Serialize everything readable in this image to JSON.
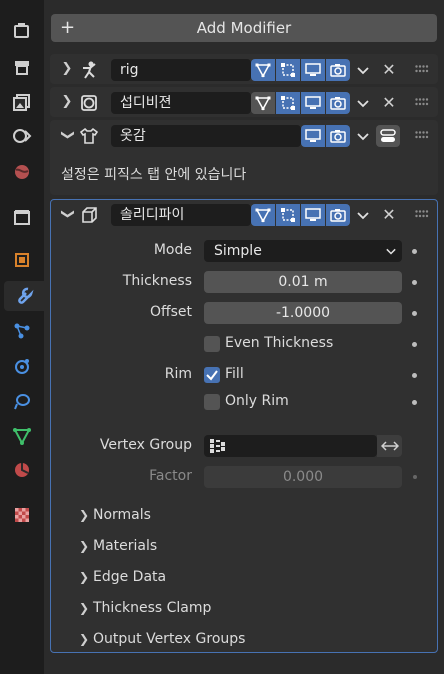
{
  "sidebar": {
    "tabs": [
      {
        "name": "tool-icon"
      },
      {
        "name": "render-icon"
      },
      {
        "name": "output-icon"
      },
      {
        "name": "view-layer-icon"
      },
      {
        "name": "scene-icon"
      },
      {
        "name": "world-icon"
      },
      {
        "name": "collection-icon"
      },
      {
        "name": "object-icon"
      },
      {
        "name": "modifier-icon"
      },
      {
        "name": "particles-icon"
      },
      {
        "name": "physics-icon"
      },
      {
        "name": "constraints-icon"
      },
      {
        "name": "data-icon"
      },
      {
        "name": "material-icon"
      },
      {
        "name": "texture-icon"
      }
    ],
    "active_tab": "modifier-icon"
  },
  "toolbar": {
    "add_modifier_label": "Add Modifier"
  },
  "modifiers": [
    {
      "name": "rig",
      "icon": "armature-icon",
      "collapsed": true
    },
    {
      "name": "섭디비젼",
      "icon": "subdivision-icon",
      "collapsed": true
    },
    {
      "name": "옷감",
      "icon": "cloth-icon",
      "collapsed": false,
      "message": "설정은 피직스 탭 안에 있습니다"
    },
    {
      "name": "솔리디파이",
      "icon": "solidify-icon",
      "collapsed": false,
      "active": true
    }
  ],
  "solidify": {
    "mode_label": "Mode",
    "mode_value": "Simple",
    "thickness_label": "Thickness",
    "thickness_value": "0.01 m",
    "offset_label": "Offset",
    "offset_value": "-1.0000",
    "even_thickness_label": "Even Thickness",
    "even_thickness_checked": false,
    "rim_label": "Rim",
    "fill_label": "Fill",
    "fill_checked": true,
    "only_rim_label": "Only Rim",
    "only_rim_checked": false,
    "vertex_group_label": "Vertex Group",
    "vertex_group_value": "",
    "factor_label": "Factor",
    "factor_value": "0.000",
    "subpanels": [
      "Normals",
      "Materials",
      "Edge Data",
      "Thickness Clamp",
      "Output Vertex Groups"
    ]
  },
  "colors": {
    "accent": "#4772b3",
    "panel": "#303030",
    "field": "#545454",
    "dark_field": "#1d1d1d"
  }
}
